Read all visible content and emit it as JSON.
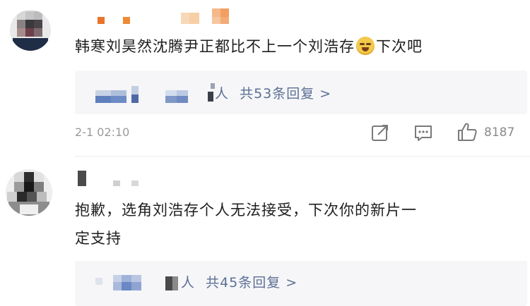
{
  "comments": [
    {
      "text_parts": [
        "韩寒刘昊然沈腾尹正都比不上一个刘浩存",
        "下次吧"
      ],
      "emoji": "laughing-tears-emoji",
      "reply_suffix": "人",
      "reply_summary": "共53条回复 >",
      "timestamp": "2-1 02:10",
      "like_count": "8187"
    },
    {
      "text_line1": "抱歉，选角刘浩存个人无法接受，下次你的新片一",
      "text_line2": "定支持",
      "reply_suffix": "人",
      "reply_summary": "共45条回复 >"
    }
  ],
  "icons": {
    "share": "share-icon",
    "comment": "comment-icon",
    "like": "thumbs-up-icon"
  },
  "colors": {
    "link": "#5b6f94",
    "reply_bg": "#f6f6f8",
    "meta": "#9a9a9a"
  }
}
